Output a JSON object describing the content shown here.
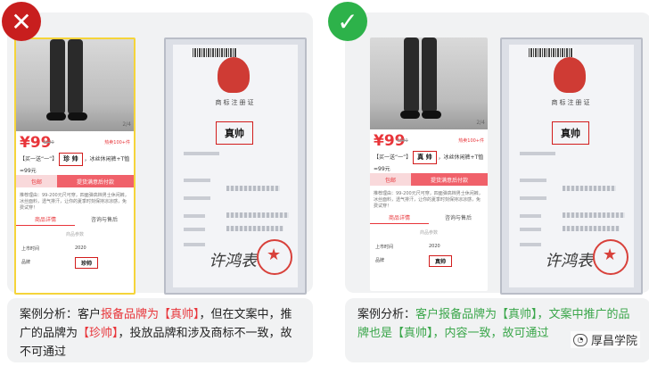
{
  "left_panel": {
    "status_icon": "x-icon",
    "product": {
      "price": "¥99",
      "old_price": "¥299",
      "sold": "热卖100+件",
      "title_prefix": "【买一送“一”】",
      "brand": "珍 帅",
      "title_suffix": "，冰丝休闲裤+T恤=99元",
      "btn_left": "包邮",
      "btn_right": "提货满意后付款",
      "desc": "推荐理由：99-200元尺可穿，四面弹高档男士休闲裤，冰丝面料，透气排汗，让你的夏季时刻保持凉凉感，免费试穿！",
      "tab_active": "商品详情",
      "tab_other": "咨询与售后",
      "param_title": "商品参数",
      "rows": [
        {
          "k": "上市时间",
          "v": "2020"
        },
        {
          "k": "品牌",
          "v": "珍帅"
        }
      ],
      "page_number": "2/4"
    },
    "certificate": {
      "title": "商标注册证",
      "mark": "真帅",
      "signature": "许鸿表"
    },
    "caption": {
      "a": "案例分析：客户",
      "b": "报备品牌为【真帅】",
      "c": "，但在文案中，推广的品牌为",
      "d": "【珍帅】",
      "e": "，投放品牌和涉及商标不一致，故不可通过"
    }
  },
  "right_panel": {
    "status_icon": "check-icon",
    "product": {
      "price": "¥99",
      "old_price": "¥299",
      "sold": "热卖100+件",
      "title_prefix": "【买一送“一”】",
      "brand": "真 帅",
      "title_suffix": "，冰丝休闲裤+T恤=99元",
      "btn_left": "包邮",
      "btn_right": "提货满意后付款",
      "desc": "推荐理由：99-200元尺可穿，四面弹高档男士休闲裤，冰丝面料，透气排汗，让你的夏季时刻保持凉凉感，免费试穿！",
      "tab_active": "商品详情",
      "tab_other": "咨询与售后",
      "param_title": "商品参数",
      "rows": [
        {
          "k": "上市时间",
          "v": "2020"
        },
        {
          "k": "品牌",
          "v": "真帅"
        }
      ],
      "page_number": "2/4"
    },
    "certificate": {
      "title": "商标注册证",
      "mark": "真帅",
      "signature": "许鸿表"
    },
    "caption": {
      "a": "案例分析：",
      "b": "客户报备品牌为【真帅】，文案中推广的品牌也是【真帅】，内容一致，故可通过",
      "watermark": "厚昌学院"
    }
  },
  "colors": {
    "accent_red": "#e8353a",
    "ok_green": "#2db24a",
    "bad_red": "#c81e1e"
  }
}
